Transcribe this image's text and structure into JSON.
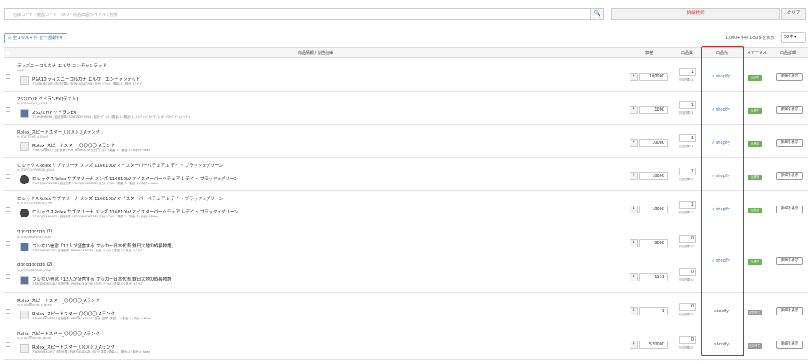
{
  "search": {
    "placeholder": "在庫コード・親品コード・SKU・商品/出品タイトルで検索",
    "btn": "🔍"
  },
  "detail_search": "詳細検索",
  "clear": "クリア",
  "bulk": "☑ 全 1,000+ 件 を一括操作 ▾",
  "count": "1,000+件中 1-50件を表示",
  "perpage": "50件 ▾",
  "headers": {
    "info": "商品情報 / 割当在庫",
    "price": "価格",
    "qty": "出品数",
    "dest": "出品先",
    "status": "ステータス",
    "detail": "出品詳細"
  },
  "rows": [
    {
      "name": "ディズニーロルカナ エルサ エンチャンテッド",
      "sku": "xit-1",
      "pname": "PSA10 ディズニーロルカナ エルサ　エンチャンテッド",
      "meta": "7TLD9Q8CDE5 / 自社在庫 / PDYMSOQ4Z758 / 区分: ﾃﾞﾌｫﾙﾄ / 数量: 1 / 数出: 1 / ｻｲｽﾞ",
      "price": "100000",
      "qty": "1",
      "alloc": "割当在庫: 1",
      "dest": "shopify",
      "status": "出品中",
      "detail": "詳細を表示"
    },
    {
      "name": "262/XY/P ヤドランEX[テスト]",
      "sku": "ic_ITUVQ9QUK_uZLY8",
      "pname": "262/XY/P ヤドランEX",
      "meta": "7TUHJ8QRUR8 / 自社在庫 / PDYTZ1Z2TWX4 / 区分: ﾃﾞﾌｫﾙﾄ / 数量: 1 / 数出: 1 / ﾄﾚｰﾃﾞｨﾝｸﾞｶｰﾄﾞｹﾞｰﾑ / ﾎﾟｹﾓﾝｶｰﾄﾞｹﾞｰﾑ / ｼﾝｸﾞﾙ",
      "price": "1000",
      "qty": "1",
      "alloc": "割当在庫: 1",
      "dest": "shopify",
      "status": "出品中",
      "detail": "詳細を表示"
    },
    {
      "name": "Rolex_スピードスター_〇〇〇〇_Aランク",
      "sku": "ic_ITXFTJ2HR1A_DuvY",
      "pname": "Rolex_スピードスター_〇〇〇〇_Aランク",
      "meta": "7TNFTJ2HR1A / 自社在庫 / PDYTRGXD1Z4 / 区分: ﾃﾞﾌｫﾙﾄ / 数量: 1 / 数出: 1 / 時計 > Rolex",
      "price": "10000",
      "qty": "1",
      "alloc": "割当在庫: 1",
      "dest": "shopify",
      "status": "出品中",
      "detail": "詳細を表示"
    },
    {
      "name": "ロレックスRolex サブマリーナ メンズ 116610LV オイスターパーペチュアル デイト ブラック×グリーン",
      "sku": "ic_ITUFQQ1YWWGD_yGw4",
      "pname": "ロレックスRolex サブマリーナ メンズ 116610LV オイスターパーペチュアル デイト ブラック×グリーン",
      "meta": "7TUFQQ1YWWGD / 自社在庫 / PDYQDHVXSCBE / 区分: ﾃﾞﾌｫﾙﾄ / 数量: 1 / 数出: 1 / 時計 > Rolex",
      "price": "10000",
      "qty": "1",
      "alloc": "割当在庫: 1",
      "dest": "shopify",
      "status": "出品中",
      "detail": "詳細を表示"
    },
    {
      "name": "ロレックスRolex サブマリーナ メンズ 116610LV オイスターパーペチュアル デイト ブラック×グリーン",
      "sku": "ic_ITUFQQ1YWWGD_iYfer",
      "pname": "ロレックスRolex サブマリーナ メンズ 116610LV オイスターパーペチュアル デイト ブラック×グリーン",
      "meta": "7TUFQQ1YWWGD / 自社在庫 / PDYQDHVXSCBE / 区分: ﾃﾞﾌｫﾙﾄ / 数量: 1 / 数出: 1 / 時計 > Rolex",
      "price": "10000",
      "qty": "1",
      "alloc": "割当在庫: 1",
      "dest": "shopify",
      "status": "出品中",
      "detail": "詳細を表示"
    },
    {
      "name": "qqqqqqqqqq (1)",
      "sku": "ic_ITNODNDRGGD_UDKs",
      "pname": "ブレない信念「12人が証言する サッカー日本代表 鎌田大地の成長物語」",
      "meta": "7TNODNDRGGD / 自社在庫 / PDYDX1X1YT3E / 区分: ﾃﾞﾌｫﾙﾄ / 数量: 0 / 数出: 1 / ｻｲｽﾞ",
      "price": "3000",
      "qty": "0",
      "alloc": "割当在庫: 0",
      "dest": "",
      "status": "",
      "detail": ""
    },
    {
      "name": "qqqqqqqqqq (2)",
      "sku": "ic_ITNODNDRGGD_UDK2",
      "pname": "ブレない信念「12人が証言する サッカー日本代表 鎌田大地の成長物語」",
      "meta": "7TNODNDRGGD / 自社在庫 / PDYDX1X1YT3E / 区分: ﾃﾞﾌｫﾙﾄ / 数量: 0 / 数出: 1 / ｻｲｽﾞ",
      "price": "1111",
      "qty": "0",
      "alloc": "割当在庫: 0",
      "dest": "shopify",
      "status": "出品中",
      "detail": "詳細を表示"
    },
    {
      "name": "Rolex_スピードスター_〇〇〇〇_Aランク",
      "sku": "ic_ITWWHBGVBZS_NGMs",
      "pname": "Rolex_スピードスター_〇〇〇〇_Aランク",
      "meta": "7TWWHBGVBZS / 自社在庫 / PDYTRGXD1Z4 / 区分: 並庫 / 数量: -- / 数出: 1 / 時計 > Rolex",
      "price": "1",
      "qty": "0",
      "alloc": "割当在庫: 0",
      "dest": "shopify",
      "status": "出品待ち",
      "detail": "詳細を表示"
    },
    {
      "name": "Rolex_スピードスター_〇〇〇〇_Aランク",
      "sku": "ic_ITWOJVB4C5RI_WUsa",
      "pname": "Rolex_スピードスター_〇〇〇〇_Aランク",
      "meta": "7TWOJVB4C5RI / 自社在庫 / PDYTRGXD1Z4 / 区分: 並庫 / 数量: -- / 数出: 1 / 時計 > Rolex",
      "price": "570000",
      "qty": "0",
      "alloc": "割当在庫: 0",
      "dest": "shopify",
      "status": "出品待ち",
      "detail": "詳細を表示"
    }
  ]
}
